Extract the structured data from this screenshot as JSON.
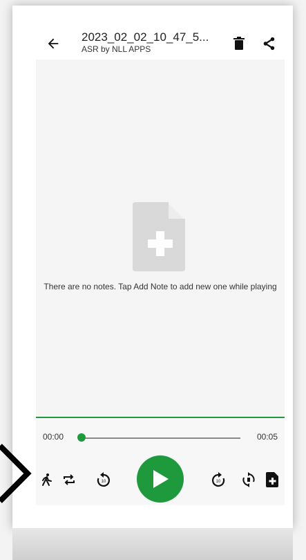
{
  "header": {
    "title": "2023_02_02_10_47_5...",
    "subtitle": "ASR by NLL APPS",
    "back_icon": "arrow-left-icon",
    "delete_icon": "trash-icon",
    "share_icon": "share-icon"
  },
  "empty_state": {
    "icon": "add-note-document-icon",
    "message": "There are no notes. Tap Add Note to add new one while playing"
  },
  "player": {
    "current_time": "00:00",
    "total_time": "00:05",
    "progress": 0.0,
    "controls": [
      {
        "name": "speed-icon"
      },
      {
        "name": "repeat-icon"
      },
      {
        "name": "rewind-10-icon"
      },
      {
        "name": "play-icon"
      },
      {
        "name": "forward-10-icon"
      },
      {
        "name": "loop-icon"
      },
      {
        "name": "add-note-icon"
      }
    ]
  },
  "colors": {
    "accent": "#1e9a3c",
    "background": "#f7f7f7",
    "icon": "#111111"
  }
}
